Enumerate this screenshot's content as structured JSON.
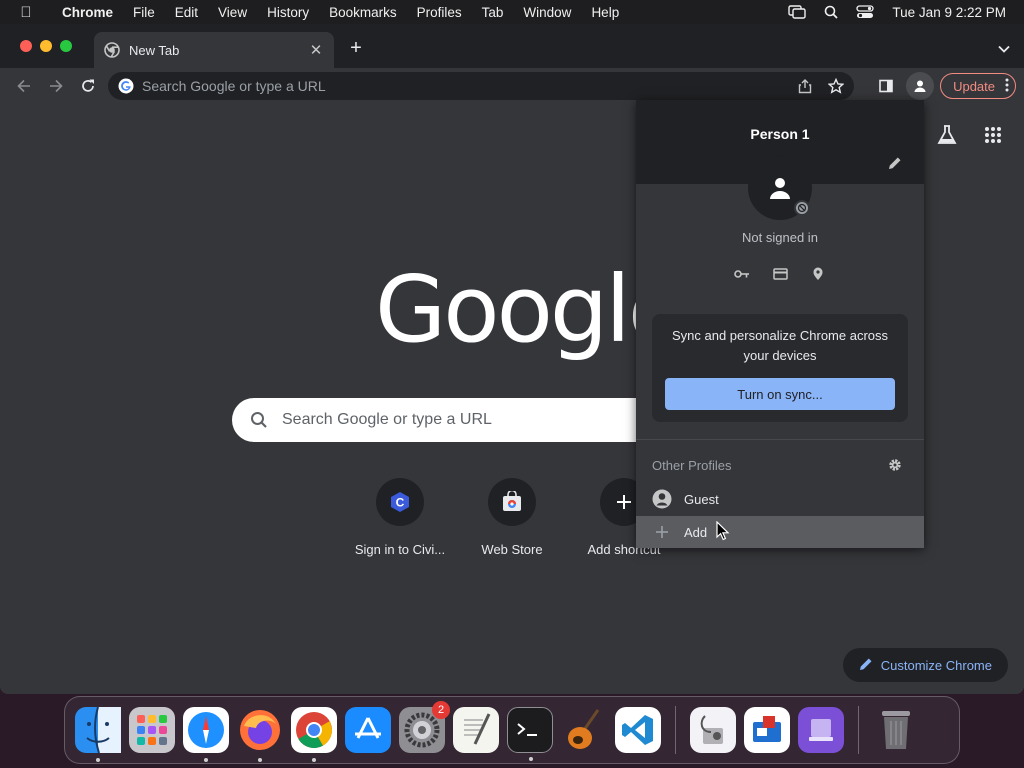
{
  "menubar": {
    "app_name": "Chrome",
    "items": [
      "File",
      "Edit",
      "View",
      "History",
      "Bookmarks",
      "Profiles",
      "Tab",
      "Window",
      "Help"
    ],
    "clock": "Tue Jan 9  2:22 PM"
  },
  "tab": {
    "title": "New Tab"
  },
  "omnibox": {
    "placeholder": "Search Google or type a URL"
  },
  "toolbar": {
    "update_label": "Update"
  },
  "ntp": {
    "logo": "Google",
    "search_placeholder": "Search Google or type a URL",
    "shortcuts": [
      {
        "label": "Sign in to Civi..."
      },
      {
        "label": "Web Store"
      },
      {
        "label": "Add shortcut"
      }
    ],
    "customize_label": "Customize Chrome"
  },
  "profile_menu": {
    "name": "Person 1",
    "status": "Not signed in",
    "sync_text": "Sync and personalize Chrome across your devices",
    "sync_button": "Turn on sync...",
    "other_profiles_title": "Other Profiles",
    "guest_label": "Guest",
    "add_label": "Add"
  },
  "dock": {
    "settings_badge": "2"
  },
  "colors": {
    "accent": "#8ab4f8",
    "update": "#f28b82",
    "window_bg": "#35363a"
  }
}
